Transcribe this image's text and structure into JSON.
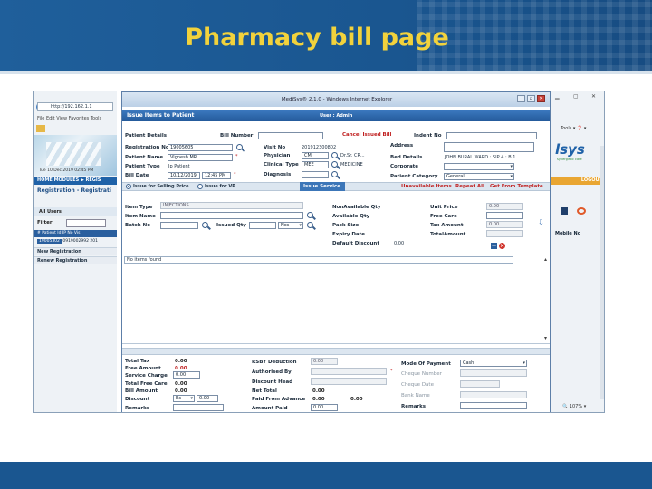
{
  "slide": {
    "title": "Pharmacy bill page"
  },
  "browser": {
    "address": "http://192.162.1.1",
    "menu": "File  Edit  View  Favorites  Tools",
    "date_line": "Tue 10 Dec 2019 02:45 PM",
    "modules_bar": "HOME    MODULES ▶  REGIS",
    "reg_title": "Registration - Registrati",
    "all_users": "All Users",
    "filter_label": "Filter",
    "table_header": "# Patient Id  IP No       Vis",
    "table_row_pid": "19005302",
    "table_row_rest": "0919002992  201",
    "new_registration": "New Registration",
    "renew_registration": "Renew Registration",
    "tools_label": "Tools ▾  ❓ ▾",
    "logo": "lsys",
    "logo_sub": "synergistic care",
    "logout": "LOGOUT",
    "mobile_no": "Mobile No",
    "zoom": "🔍 107%  ▾"
  },
  "popup": {
    "window_title": "MediSys® 2.1.0 - Windows Internet Explorer",
    "header": "Issue Items to Patient",
    "user": "User : Admin",
    "patient_details": "Patient Details",
    "bill_number_label": "Bill Number",
    "cancel_issued_bill": "Cancel Issued Bill",
    "indent_no_label": "Indent No",
    "registration_no_label": "Registration No",
    "registration_no": "19005605",
    "patient_name_label": "Patient Name",
    "patient_name": "Vignesh MR",
    "patient_type_label": "Patient Type",
    "patient_type": "Ip Patient",
    "bill_date_label": "Bill Date",
    "bill_date": "10/12/2019",
    "bill_time": "12:45 PM",
    "visit_no_label": "Visit No",
    "visit_no": "201912300802",
    "physician_label": "Physician",
    "physician_code": "CM",
    "physician_name": "Dr.Sr. CR...",
    "clinical_type_label": "Clinical Type",
    "clinical_type_code": "MEE",
    "clinical_type_name": "MEDICINE",
    "diagnosis_label": "Diagnosis",
    "address_label": "Address",
    "bed_details_label": "Bed Details",
    "bed_details": "JOHN BURAL WARD : SIP 4 : B 1",
    "corporate_label": "Corporate",
    "patient_category_label": "Patient Category",
    "patient_category": "General",
    "issue_selling_price": "Issue for Selling Price",
    "issue_vp": "Issue for VP",
    "issue_service": "Issue Service",
    "unavailable_items": "Unavailable Items",
    "repeat_all": "Repeat All",
    "get_from_template": "Get From Template",
    "item_type_label": "Item Type",
    "item_type": "INJECTIONS",
    "item_name_label": "Item Name",
    "batch_no_label": "Batch No",
    "issued_qty_label": "Issued Qty",
    "issued_unit": "Nos",
    "non_available_qty_label": "NonAvailable Qty",
    "available_qty_label": "Available Qty",
    "pack_size_label": "Pack Size",
    "expiry_date_label": "Expiry Date",
    "default_discount_label": "Default Discount",
    "default_discount": "0.00",
    "unit_price_label": "Unit Price",
    "unit_price": "0.00",
    "free_care_label": "Free Care",
    "tax_amount_label": "Tax Amount",
    "tax_amount": "0.00",
    "total_amount_label": "TotalAmount",
    "no_items": "No items found",
    "total_tax_label": "Total Tax",
    "total_tax": "0.00",
    "free_amount_label": "Free Amount",
    "free_amount": "0.00",
    "service_charge_label": "Service Charge",
    "service_charge": "0.00",
    "total_free_care_label": "Total Free Care",
    "total_free_care": "0.00",
    "bill_amount_label": "Bill Amount",
    "bill_amount": "0.00",
    "discount_label": "Discount",
    "discount_type": "Rs",
    "discount_value": "0.00",
    "remarks_label": "Remarks",
    "rsby_deduction_label": "RSBY Deduction",
    "rsby_deduction": "0.00",
    "authorised_by_label": "Authorised By",
    "discount_head_label": "Discount Head",
    "net_total_label": "Net Total",
    "net_total": "0.00",
    "paid_from_advance_label": "Paid From Advance",
    "paid_from_advance": "0.00",
    "paid_from_advance_input": "0.00",
    "amount_paid_label": "Amount Paid",
    "amount_paid": "0.00",
    "mode_of_payment_label": "Mode Of Payment",
    "mode_of_payment": "Cash",
    "cheque_number_label": "Cheque Number",
    "cheque_date_label": "Cheque Date",
    "bank_name_label": "Bank Name",
    "remarks2_label": "Remarks"
  },
  "colors": {
    "header_blue": "#1a5690",
    "title_yellow": "#f2d23c",
    "accent_red": "#c02020"
  }
}
